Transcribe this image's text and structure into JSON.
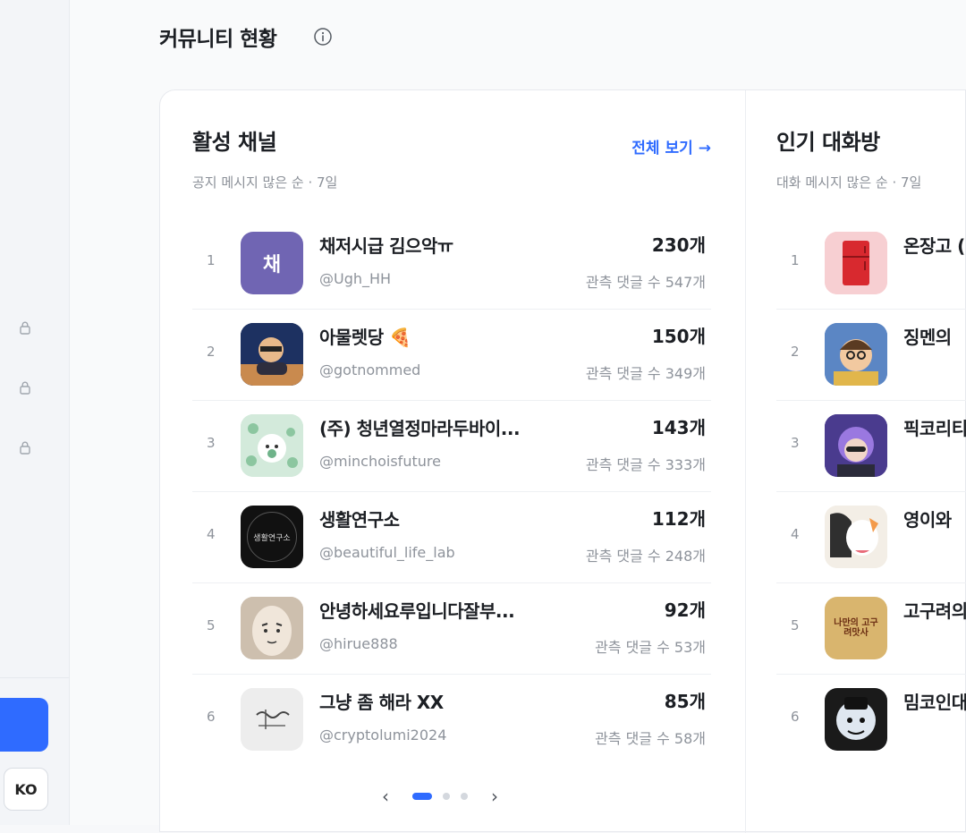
{
  "sidebar": {
    "lang_label": "KO"
  },
  "page": {
    "title": "커뮤니티 현황"
  },
  "active_channels": {
    "title": "활성 채널",
    "subtitle": "공지 메시지 많은 순 · 7일",
    "see_all": "전체 보기",
    "items": [
      {
        "rank": "1",
        "name": "채저시급 김으악ㅠ",
        "handle": "@Ugh_HH",
        "count": "230개",
        "sub": "관측 댓글 수 547개",
        "avatar_text": "채",
        "avatar_color": "#7065b3"
      },
      {
        "rank": "2",
        "name": "아물렛당 🍕",
        "handle": "@gotnommed",
        "count": "150개",
        "sub": "관측 댓글 수 349개"
      },
      {
        "rank": "3",
        "name": "(주) 청년열정마라두바이...",
        "handle": "@minchoisfuture",
        "count": "143개",
        "sub": "관측 댓글 수 333개"
      },
      {
        "rank": "4",
        "name": "생활연구소",
        "handle": "@beautiful_life_lab",
        "count": "112개",
        "sub": "관측 댓글 수 248개",
        "avatar_text": "생활연구소"
      },
      {
        "rank": "5",
        "name": "안녕하세요루입니다잘부...",
        "handle": "@hirue888",
        "count": "92개",
        "sub": "관측 댓글 수 53개"
      },
      {
        "rank": "6",
        "name": "그냥 좀 해라 XX",
        "handle": "@cryptolumi2024",
        "count": "85개",
        "sub": "관측 댓글 수 58개"
      }
    ]
  },
  "popular_chats": {
    "title": "인기 대화방",
    "subtitle": "대화 메시지 많은 순 · 7일",
    "items": [
      {
        "rank": "1",
        "name": "온장고 ("
      },
      {
        "rank": "2",
        "name": "징멘의 "
      },
      {
        "rank": "3",
        "name": "픽코리티"
      },
      {
        "rank": "4",
        "name": "영이와 "
      },
      {
        "rank": "5",
        "name": "고구려의",
        "avatar_text": "나만의 고구려맛사"
      },
      {
        "rank": "6",
        "name": "밈코인대"
      }
    ]
  },
  "pager": {
    "prev": "‹",
    "next": "›"
  }
}
